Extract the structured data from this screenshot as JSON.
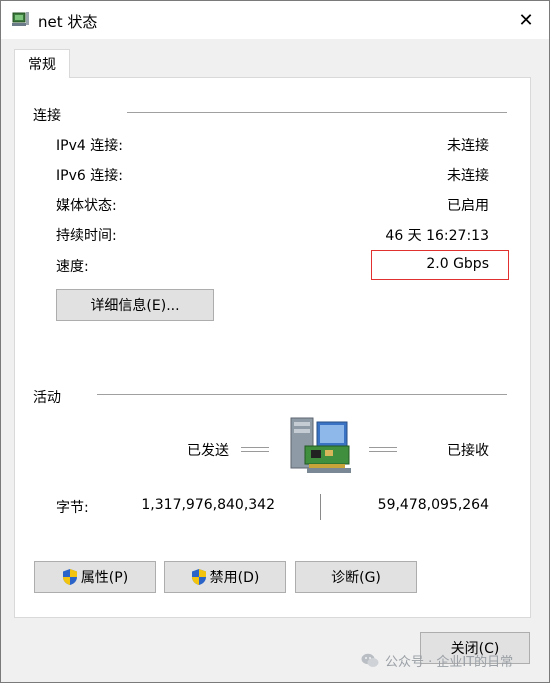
{
  "window": {
    "title": "net 状态",
    "close_glyph": "✕"
  },
  "tabs": [
    {
      "label": "常规"
    }
  ],
  "connection": {
    "group_title": "连接",
    "rows": [
      {
        "label": "IPv4 连接:",
        "value": "未连接"
      },
      {
        "label": "IPv6 连接:",
        "value": "未连接"
      },
      {
        "label": "媒体状态:",
        "value": "已启用"
      },
      {
        "label": "持续时间:",
        "value": "46 天 16:27:13"
      },
      {
        "label": "速度:",
        "value": "2.0 Gbps"
      }
    ],
    "details_button": "详细信息(E)..."
  },
  "activity": {
    "group_title": "活动",
    "sent_label": "已发送",
    "received_label": "已接收",
    "bytes_label": "字节:",
    "bytes_sent": "1,317,976,840,342",
    "bytes_received": "59,478,095,264",
    "icon": "network-adapter-icon"
  },
  "buttons": {
    "properties": "属性(P)",
    "disable": "禁用(D)",
    "diagnose": "诊断(G)",
    "close": "关闭(C)"
  },
  "watermark": {
    "text": "公众号 · 企业IT的日常",
    "icon": "wechat-icon"
  },
  "colors": {
    "highlight_border": "#e03030",
    "shield_blue": "#2a64c8",
    "shield_yellow": "#f2c40f"
  }
}
